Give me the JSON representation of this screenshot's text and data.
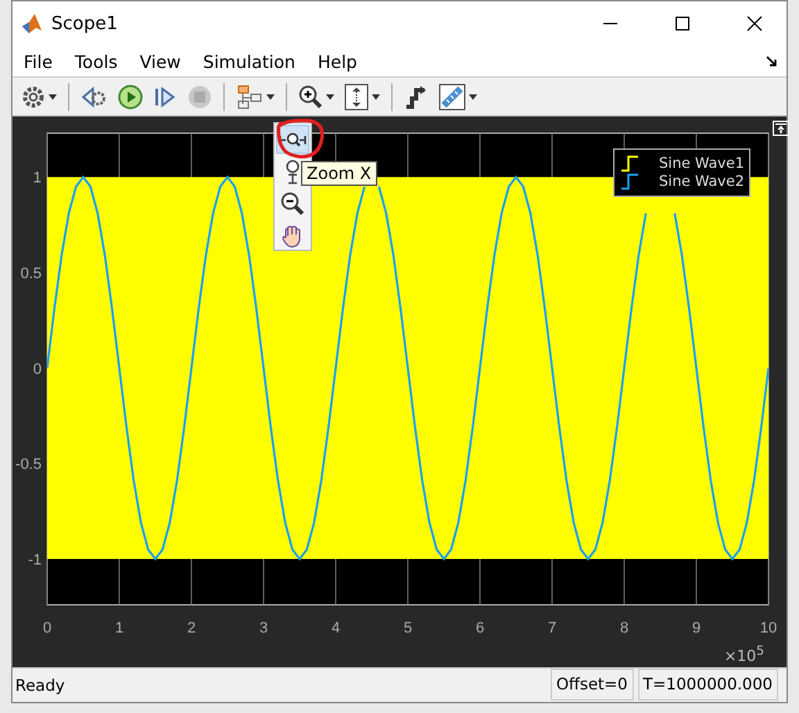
{
  "window": {
    "title": "Scope1"
  },
  "menu": [
    "File",
    "Tools",
    "View",
    "Simulation",
    "Help"
  ],
  "toolbar": [
    {
      "kind": "gear",
      "caret": true
    },
    {
      "kind": "sep"
    },
    {
      "kind": "step-back",
      "caret": false
    },
    {
      "kind": "run",
      "caret": false
    },
    {
      "kind": "step-forward",
      "caret": false
    },
    {
      "kind": "stop",
      "caret": false,
      "disabled": true
    },
    {
      "kind": "sep"
    },
    {
      "kind": "hierarchy",
      "caret": true
    },
    {
      "kind": "sep"
    },
    {
      "kind": "zoom",
      "caret": true
    },
    {
      "kind": "scale",
      "caret": true
    },
    {
      "kind": "sep"
    },
    {
      "kind": "highlight",
      "caret": false
    },
    {
      "kind": "measure",
      "caret": true
    }
  ],
  "zoom_menu": {
    "items": [
      {
        "kind": "zoom-x",
        "selected": true
      },
      {
        "kind": "zoom-y",
        "selected": false
      },
      {
        "kind": "zoom-out",
        "selected": false
      },
      {
        "kind": "pan",
        "selected": false
      }
    ],
    "tooltip": "Zoom X"
  },
  "plot": {
    "chart_data": {
      "type": "line",
      "grid": true,
      "bands": [
        {
          "axis": "y",
          "from": -1,
          "to": 1,
          "color": "#ffff00"
        }
      ],
      "xlim": [
        0,
        10
      ],
      "ylim": [
        -1.24,
        1.23
      ],
      "xticks": [
        0,
        1,
        2,
        3,
        4,
        5,
        6,
        7,
        8,
        9,
        10
      ],
      "yticks": [
        -1,
        -0.5,
        0,
        0.5,
        1
      ],
      "x": [
        0,
        0.1,
        0.2,
        0.3,
        0.4,
        0.5,
        0.6,
        0.7,
        0.8,
        0.9,
        1,
        1.1,
        1.2,
        1.3,
        1.4,
        1.5,
        1.6,
        1.7,
        1.8,
        1.9,
        2,
        2.1,
        2.2,
        2.3,
        2.4,
        2.5,
        2.6,
        2.7,
        2.8,
        2.9,
        3,
        3.1,
        3.2,
        3.3,
        3.4,
        3.5,
        3.6,
        3.7,
        3.8,
        3.9,
        4,
        4.1,
        4.2,
        4.3,
        4.4,
        4.5,
        4.6,
        4.7,
        4.8,
        4.9,
        5,
        5.1,
        5.2,
        5.3,
        5.4,
        5.5,
        5.6,
        5.7,
        5.8,
        5.9,
        6,
        6.1,
        6.2,
        6.3,
        6.4,
        6.5,
        6.6,
        6.7,
        6.8,
        6.9,
        7,
        7.1,
        7.2,
        7.3,
        7.4,
        7.5,
        7.6,
        7.7,
        7.8,
        7.9,
        8,
        8.1,
        8.2,
        8.3,
        8.4,
        8.5,
        8.6,
        8.7,
        8.8,
        8.9,
        9,
        9.1,
        9.2,
        9.3,
        9.4,
        9.5,
        9.6,
        9.7,
        9.8,
        9.9,
        10
      ],
      "series": [
        {
          "name": "Sine Wave1",
          "color": "#ffff00",
          "values": [
            null,
            null,
            null,
            null,
            null,
            null,
            null,
            null,
            null,
            null,
            null,
            null,
            null,
            null,
            null,
            null,
            null,
            null,
            null,
            null,
            null,
            null,
            null,
            null,
            null,
            null,
            null,
            null,
            null,
            null,
            null,
            null,
            null,
            null,
            null,
            null,
            null,
            null,
            null,
            null,
            null,
            null,
            null,
            null,
            null,
            null,
            null,
            null,
            null,
            null,
            null,
            null,
            null,
            null,
            null,
            null,
            null,
            null,
            null,
            null,
            null,
            null,
            null,
            null,
            null,
            null,
            null,
            null,
            null,
            null,
            null,
            null,
            null,
            null,
            null,
            null,
            null,
            null,
            null,
            null,
            null,
            null,
            null,
            null,
            null,
            null,
            null,
            null,
            null,
            null,
            null,
            null,
            null,
            null,
            null,
            null,
            null,
            null,
            null,
            null,
            null
          ]
        },
        {
          "name": "Sine Wave2",
          "color": "#1ea0f0",
          "values": [
            0,
            0.31,
            0.59,
            0.81,
            0.95,
            1,
            0.95,
            0.81,
            0.59,
            0.31,
            0,
            -0.31,
            -0.59,
            -0.81,
            -0.95,
            -1,
            -0.95,
            -0.81,
            -0.59,
            -0.31,
            0,
            0.31,
            0.59,
            0.81,
            0.95,
            1,
            0.95,
            0.81,
            0.59,
            0.31,
            0,
            -0.31,
            -0.59,
            -0.81,
            -0.95,
            -1,
            -0.95,
            -0.81,
            -0.59,
            -0.31,
            0,
            0.31,
            0.59,
            0.81,
            0.95,
            null,
            0.95,
            0.81,
            0.59,
            0.31,
            0,
            -0.31,
            -0.59,
            -0.81,
            -0.95,
            -1,
            -0.95,
            -0.81,
            -0.59,
            -0.31,
            0,
            0.31,
            0.59,
            0.81,
            0.95,
            1,
            0.95,
            0.81,
            0.59,
            0.31,
            0,
            -0.31,
            -0.59,
            -0.81,
            -0.95,
            -1,
            -0.95,
            -0.81,
            -0.59,
            -0.31,
            0,
            0.31,
            0.59,
            0.81,
            null,
            null,
            null,
            0.81,
            0.59,
            0.31,
            0,
            -0.31,
            -0.59,
            -0.81,
            -0.95,
            -1,
            -0.95,
            -0.81,
            -0.59,
            -0.31,
            0
          ]
        }
      ]
    },
    "axis_multiplier": "×10$^{5}$"
  },
  "status_bar": {
    "message": "Ready",
    "fields": [
      "Offset=0",
      "T=1000000.000"
    ]
  }
}
